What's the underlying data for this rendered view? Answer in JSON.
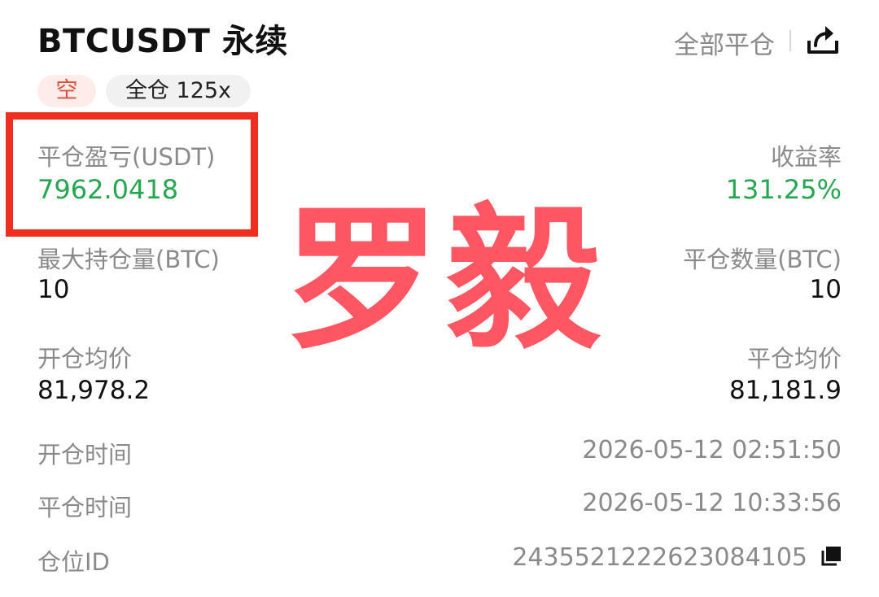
{
  "header": {
    "title": "BTCUSDT 永续",
    "close_all_label": "全部平仓",
    "share_icon": "share-icon"
  },
  "tags": {
    "side": "空",
    "margin_leverage": "全仓 125x"
  },
  "stats": {
    "pnl_label": "平仓盈亏(USDT)",
    "pnl_value": "7962.0418",
    "roi_label": "收益率",
    "roi_value": "131.25%",
    "max_position_label": "最大持仓量(BTC)",
    "max_position_value": "10",
    "close_qty_label": "平仓数量(BTC)",
    "close_qty_value": "10",
    "open_avg_label": "开仓均价",
    "open_avg_value": "81,978.2",
    "close_avg_label": "平仓均价",
    "close_avg_value": "81,181.9"
  },
  "details": {
    "open_time_label": "开仓时间",
    "open_time_value": "2026-05-12 02:51:50",
    "close_time_label": "平仓时间",
    "close_time_value": "2026-05-12 10:33:56",
    "position_id_label": "仓位ID",
    "position_id_value": "2435521222623084105",
    "copy_icon": "copy-icon"
  },
  "watermark": {
    "text": "罗毅"
  },
  "colors": {
    "profit_green": "#25a750",
    "short_red": "#e0503c",
    "annotation_red": "#ee2e1f",
    "watermark_red": "#ff4e5b"
  }
}
